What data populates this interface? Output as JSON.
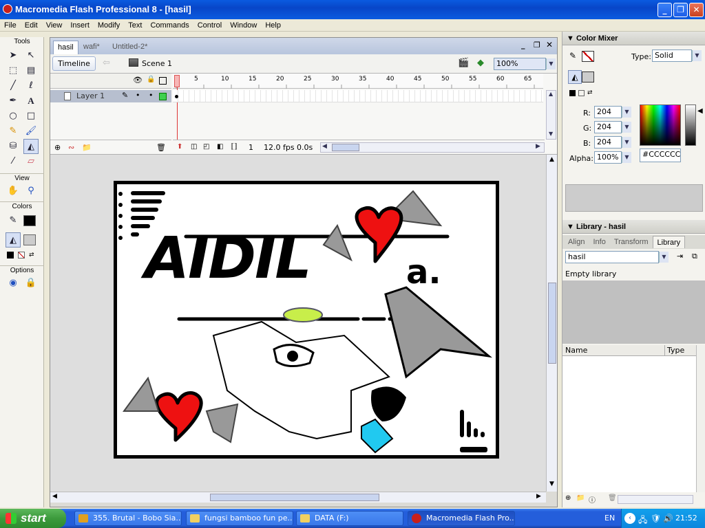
{
  "window": {
    "title": "Macromedia Flash Professional 8 - [hasil]"
  },
  "menu": [
    "File",
    "Edit",
    "View",
    "Insert",
    "Modify",
    "Text",
    "Commands",
    "Control",
    "Window",
    "Help"
  ],
  "tools": {
    "header": "Tools",
    "view_header": "View",
    "colors_header": "Colors",
    "options_header": "Options"
  },
  "doc": {
    "tabs": [
      "hasil",
      "wafi*",
      "Untitled-2*"
    ],
    "timeline_button": "Timeline",
    "scene": "Scene 1",
    "zoom": "100%"
  },
  "timeline": {
    "layer": "Layer 1",
    "ruler": [
      "1",
      "5",
      "10",
      "15",
      "20",
      "25",
      "30",
      "35",
      "40",
      "45",
      "50",
      "55",
      "60",
      "65"
    ],
    "current_frame": "1",
    "fps": "12.0 fps",
    "time": "0.0s"
  },
  "artwork": {
    "name_text": "AIDIL",
    "suffix_text": "a."
  },
  "color_mixer": {
    "title": "Color Mixer",
    "type_label": "Type:",
    "type_value": "Solid",
    "r_label": "R:",
    "r": "204",
    "g_label": "G:",
    "g": "204",
    "b_label": "B:",
    "b": "204",
    "alpha_label": "Alpha:",
    "alpha": "100%",
    "hex": "#CCCCCC"
  },
  "library": {
    "title": "Library - hasil",
    "tabs": [
      "Align",
      "Info",
      "Transform",
      "Library"
    ],
    "doc_select": "hasil",
    "empty": "Empty library",
    "col_name": "Name",
    "col_type": "Type"
  },
  "taskbar": {
    "start": "start",
    "tasks": [
      "355. Brutal - Bobo Sia...",
      "fungsi bamboo fun pe...",
      "DATA (F:)",
      "Macromedia Flash Pro..."
    ],
    "lang": "EN",
    "clock": "21:52"
  },
  "colors": {
    "titlebar": "#0a5be0",
    "stage_bg": "#ffffff",
    "heart": "#ee1111",
    "mixer_gray": "#cccccc"
  }
}
